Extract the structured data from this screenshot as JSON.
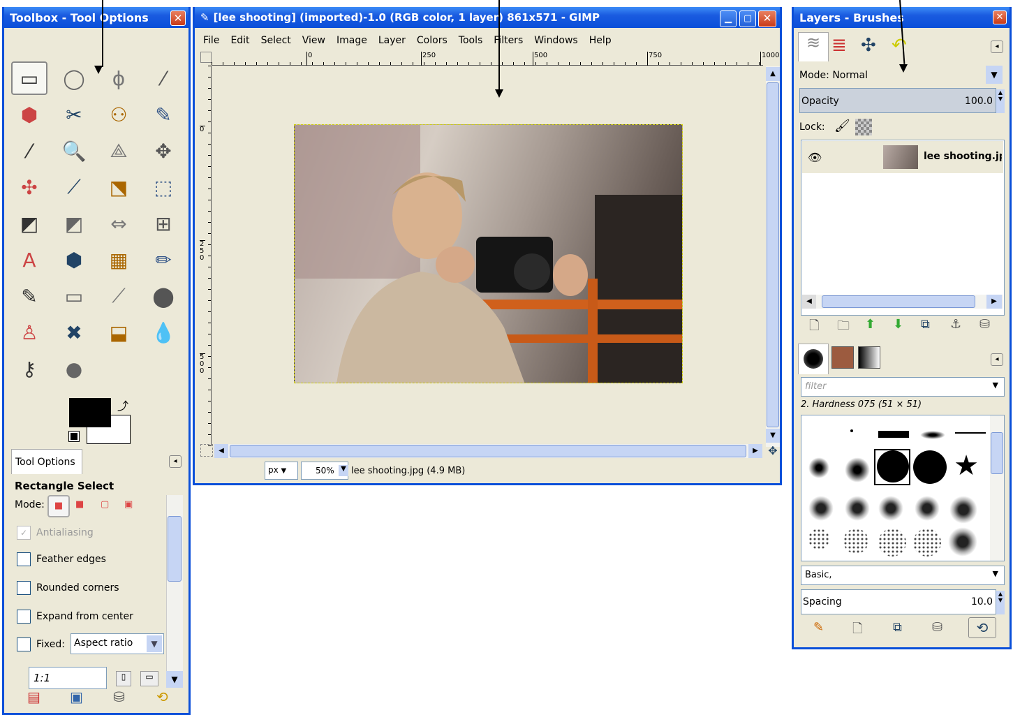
{
  "toolbox": {
    "title": "Toolbox - Tool Options",
    "tool_options_tab": "Tool Options",
    "tool_name": "Rectangle Select",
    "mode_label": "Mode:",
    "antialiasing": "Antialiasing",
    "feather": "Feather edges",
    "rounded": "Rounded corners",
    "expand": "Expand from center",
    "fixed_label": "Fixed:",
    "fixed_value": "Aspect ratio",
    "ratio_value": "1:1",
    "tools": [
      "▭",
      "◯",
      "ϕ",
      "⁄",
      "⬢",
      "✂",
      "⚇",
      "✎",
      "⁄",
      "🔍",
      "⟁",
      "✥",
      "✣",
      "⟋",
      "⬔",
      "⬚",
      "◩",
      "◩",
      "⇔",
      "⊞",
      "A",
      "⬢",
      "▦",
      "✏",
      "✎",
      "▭",
      "⟋",
      "⬤",
      "♙",
      "✖",
      "⬓",
      "💧",
      "⚷",
      "●"
    ],
    "bottom_icons": [
      "save-icon",
      "restore-icon",
      "delete-icon",
      "reset-icon"
    ]
  },
  "image_window": {
    "title": "[lee shooting] (imported)-1.0 (RGB color, 1 layer) 861x571 - GIMP",
    "menu": [
      "File",
      "Edit",
      "Select",
      "View",
      "Image",
      "Layer",
      "Colors",
      "Tools",
      "Filters",
      "Windows",
      "Help"
    ],
    "ruler_labels": [
      "0",
      "250",
      "500",
      "750",
      "1000"
    ],
    "vruler_labels": [
      "0",
      "250",
      "500"
    ],
    "unit": "px",
    "zoom": "50%",
    "status": "lee shooting.jpg (4.9 MB)"
  },
  "layers": {
    "title": "Layers - Brushes",
    "mode_label": "Mode:",
    "mode_value": "Normal",
    "opacity_label": "Opacity",
    "opacity_value": "100.0",
    "lock_label": "Lock:",
    "layer_name": "lee shooting.jpg"
  },
  "brushes": {
    "filter_placeholder": "filter",
    "current": "2. Hardness 075 (51 × 51)",
    "category": "Basic,",
    "spacing_label": "Spacing",
    "spacing_value": "10.0"
  }
}
